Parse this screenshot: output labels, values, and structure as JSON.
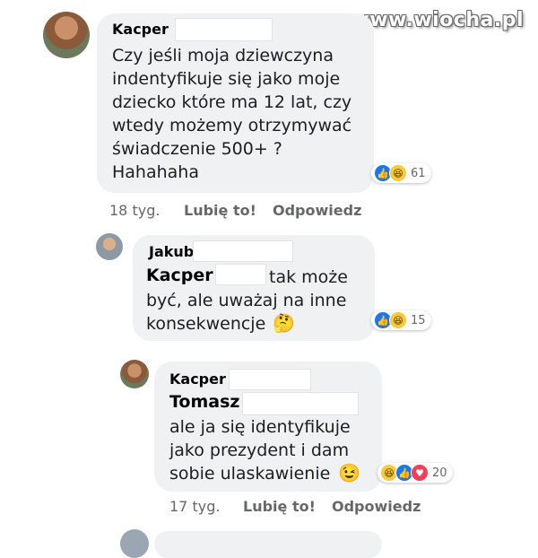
{
  "watermark": "www.wiocha.pl",
  "comments": [
    {
      "author": "Kacper",
      "text": "Czy jeśli moja dziewczyna\nindentyfikuje się jako moje\ndziecko które ma 12 lat, czy\nwtedy możemy otrzymywać\nświadczenie 500+ ?\nHahahaha",
      "reaction_count": "61",
      "time": "18 tyg.",
      "like_label": "Lubię to!",
      "reply_label": "Odpowiedz"
    },
    {
      "author": "Jakub",
      "mention": "Kacper",
      "text_first": "tak może",
      "text": "być, ale uważaj na inne\nkonsekwencje",
      "emoji": "🤔",
      "reaction_count": "15"
    },
    {
      "author": "Kacper",
      "mention": "Tomasz",
      "text": "ale ja się identyfikuje\njako prezydent i dam\nsobie ulaskawienie",
      "emoji": "😉",
      "reaction_count": "20",
      "time": "17 tyg.",
      "like_label": "Lubię to!",
      "reply_label": "Odpowiedz"
    }
  ],
  "icons": {
    "like": "like-icon",
    "haha": "haha-icon",
    "love": "love-icon"
  },
  "colors": {
    "bubble": "#eff1f3",
    "like": "#1877f2",
    "haha": "#f7c93b",
    "love": "#f33e58",
    "meta": "#65676b"
  }
}
